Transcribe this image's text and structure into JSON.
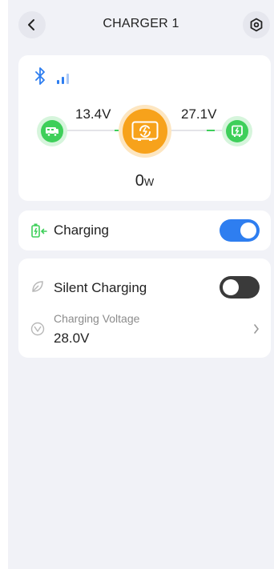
{
  "header": {
    "title": "CHARGER 1",
    "back_icon": "chevron-left-icon",
    "settings_icon": "hexagon-settings-icon"
  },
  "status_card": {
    "bluetooth_icon": "bluetooth-icon",
    "signal_icon": "signal-bars-icon",
    "input_voltage": "13.4V",
    "output_voltage": "27.1V",
    "power_value": "0",
    "power_unit": "W",
    "source_icon": "vehicle-icon",
    "charger_icon": "charger-device-icon",
    "battery_icon": "battery-device-icon",
    "accent_green": "#3ecf5a",
    "accent_orange": "#f7a21b"
  },
  "charging_card": {
    "label": "Charging",
    "icon": "battery-charging-icon",
    "enabled": true,
    "toggle_color": "#2e7ef0"
  },
  "settings_card": {
    "silent_label": "Silent Charging",
    "silent_icon": "leaf-icon",
    "silent_enabled": false,
    "voltage_label": "Charging Voltage",
    "voltage_value": "28.0V",
    "voltage_icon": "gauge-icon",
    "chevron_icon": "chevron-right-icon"
  }
}
